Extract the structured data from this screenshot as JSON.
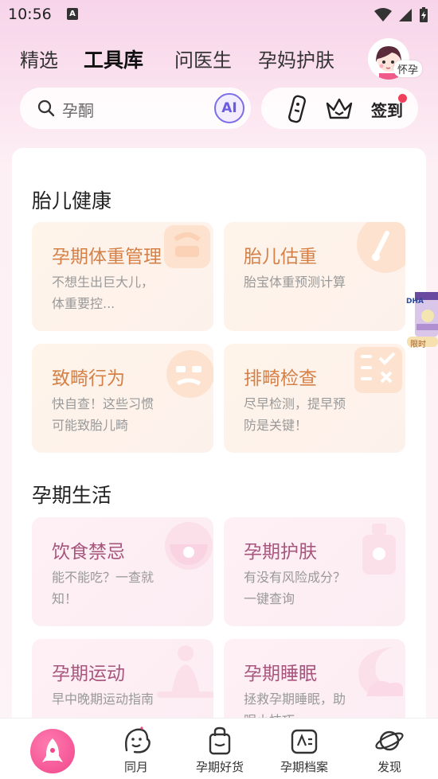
{
  "status_bar": {
    "time": "10:56",
    "notification_letter": "A"
  },
  "top_tabs": [
    {
      "label": "精选",
      "active": false
    },
    {
      "label": "工具库",
      "active": true
    },
    {
      "label": "问医生",
      "active": false
    },
    {
      "label": "孕妈护肤",
      "active": false
    }
  ],
  "profile": {
    "stage_label": "怀孕"
  },
  "search": {
    "placeholder": "孕酮",
    "ai_label": "AI"
  },
  "actions": {
    "checkin_label": "签到"
  },
  "sections": [
    {
      "title": "胎儿健康",
      "tools": [
        {
          "title": "孕期体重管理",
          "desc": "不想生出巨大儿，体重要控...",
          "icon": "scale-icon"
        },
        {
          "title": "胎儿估重",
          "desc": "胎宝体重预测计算",
          "icon": "gauge-icon"
        },
        {
          "title": "致畸行为",
          "desc": "快自查！这些习惯可能致胎儿畸",
          "icon": "face-icon"
        },
        {
          "title": "排畸检查",
          "desc": "尽早检测，提早预防是关键！",
          "icon": "checklist-icon"
        }
      ]
    },
    {
      "title": "孕期生活",
      "tools": [
        {
          "title": "饮食禁忌",
          "desc": "能不能吃？一查就知！",
          "icon": "bowl-icon"
        },
        {
          "title": "孕期护肤",
          "desc": "有没有风险成分？一键查询",
          "icon": "lotion-icon"
        },
        {
          "title": "孕期运动",
          "desc": "早中晚期运动指南",
          "icon": "yoga-icon"
        },
        {
          "title": "孕期睡眠",
          "desc": "拯救孕期睡眠，助眠小技巧",
          "icon": "moon-icon"
        }
      ]
    }
  ],
  "float_ad": {
    "brand": "DHA",
    "tag": "限时"
  },
  "bottom_nav": [
    {
      "label": "",
      "icon": "rocket-home-icon"
    },
    {
      "label": "同月",
      "icon": "smile-face-icon"
    },
    {
      "label": "孕期好货",
      "icon": "shopping-bag-icon"
    },
    {
      "label": "孕期档案",
      "icon": "id-card-icon"
    },
    {
      "label": "发现",
      "icon": "planet-icon"
    }
  ],
  "colors": {
    "accent_pink": "#f0478a",
    "warm_title": "#d58046",
    "pink_title": "#a8557d",
    "ai_purple": "#6a5ce0"
  }
}
